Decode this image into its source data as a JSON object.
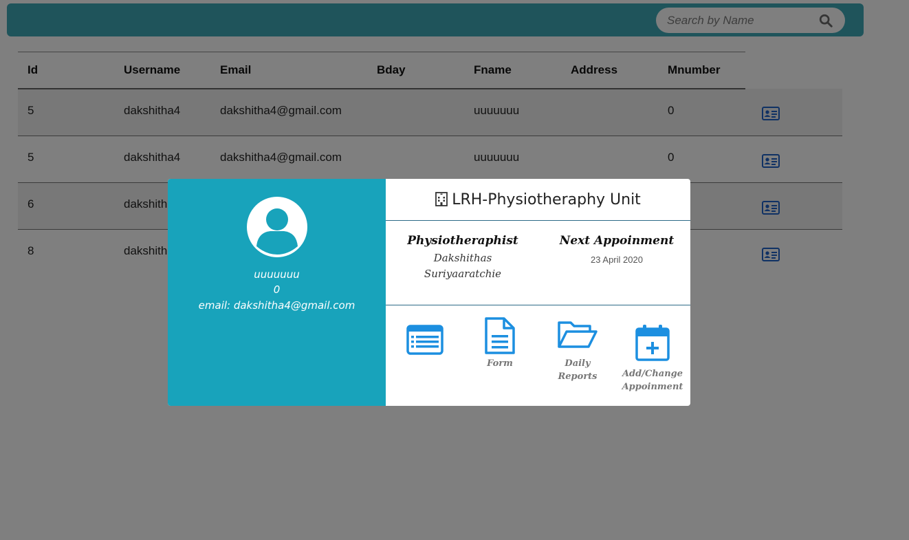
{
  "search": {
    "placeholder": "Search by Name"
  },
  "table": {
    "headers": [
      "Id",
      "Username",
      "Email",
      "Bday",
      "Fname",
      "Address",
      "Mnumber"
    ],
    "rows": [
      {
        "id": "5",
        "username": "dakshitha4",
        "email": "dakshitha4@gmail.com",
        "bday": "",
        "fname": "uuuuuuu",
        "address": "",
        "mnumber": "0"
      },
      {
        "id": "5",
        "username": "dakshitha4",
        "email": "dakshitha4@gmail.com",
        "bday": "",
        "fname": "uuuuuuu",
        "address": "",
        "mnumber": "0"
      },
      {
        "id": "6",
        "username": "dakshitha4",
        "email": "",
        "bday": "",
        "fname": "",
        "address": "",
        "mnumber": ""
      },
      {
        "id": "8",
        "username": "dakshitha4",
        "email": "",
        "bday": "",
        "fname": "",
        "address": "",
        "mnumber": ""
      }
    ]
  },
  "modal": {
    "patient": {
      "name": "uuuuuuu",
      "mobile": "0",
      "email_line": "email: dakshitha4@gmail.com"
    },
    "unit_title": "LRH-Physiotheraphy Unit",
    "physio": {
      "label": "Physiotheraphist",
      "name_line1": "Dakshithas",
      "name_line2": "Suriyaaratchie"
    },
    "appointment": {
      "label": "Next Appoinment",
      "date": "23 April 2020"
    },
    "actions": {
      "list_label": "",
      "form_label": "Form",
      "reports_label": "Daily Reports",
      "appointment_label_line1": "Add/Change",
      "appointment_label_line2": "Appoinment"
    }
  },
  "colors": {
    "topbar": "#3ea9b7",
    "modal_left": "#18a3bb",
    "action_icon": "#1c8fe0",
    "card_icon": "#1f62c8"
  }
}
